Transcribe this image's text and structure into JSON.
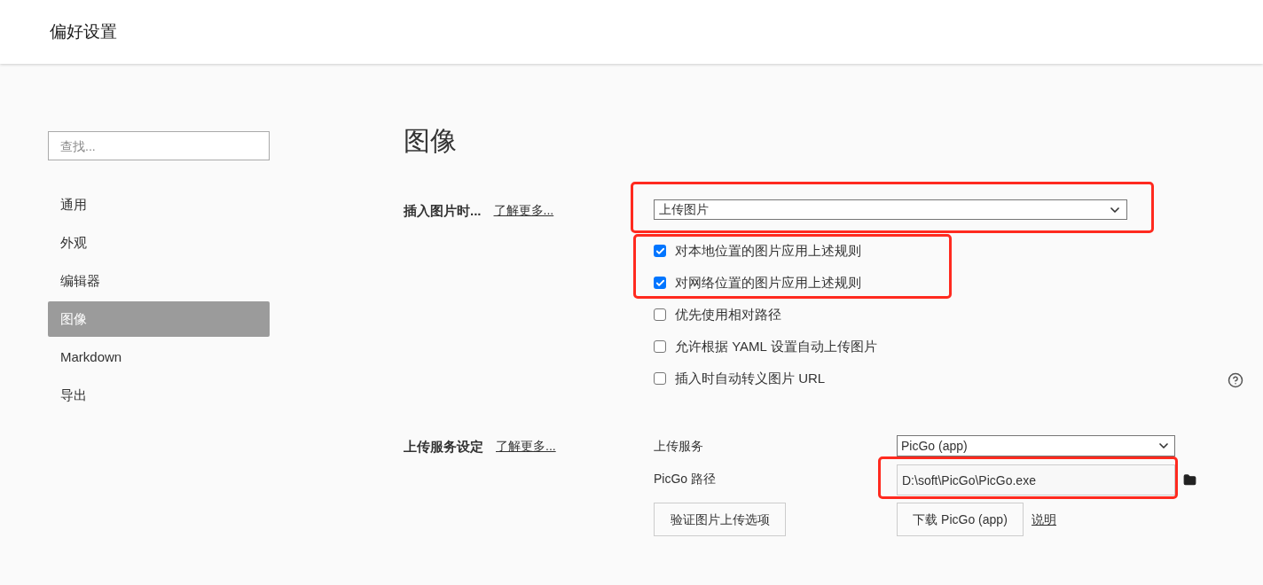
{
  "header": {
    "title": "偏好设置"
  },
  "sidebar": {
    "search": {
      "placeholder": "查找..."
    },
    "items": [
      {
        "label": "通用",
        "selected": false
      },
      {
        "label": "外观",
        "selected": false
      },
      {
        "label": "编辑器",
        "selected": false
      },
      {
        "label": "图像",
        "selected": true
      },
      {
        "label": "Markdown",
        "selected": false
      },
      {
        "label": "导出",
        "selected": false
      }
    ]
  },
  "page": {
    "title": "图像",
    "insert": {
      "label": "插入图片时...",
      "link": "了解更多...",
      "select": "上传图片",
      "options": [
        {
          "label": "对本地位置的图片应用上述规则",
          "checked": true
        },
        {
          "label": "对网络位置的图片应用上述规则",
          "checked": true
        },
        {
          "label": "优先使用相对路径",
          "checked": false
        },
        {
          "label": "允许根据 YAML 设置自动上传图片",
          "checked": false
        },
        {
          "label": "插入时自动转义图片 URL",
          "checked": false
        }
      ]
    },
    "upload": {
      "label": "上传服务设定",
      "link": "了解更多...",
      "service_label": "上传服务",
      "service": "PicGo (app)",
      "path_label": "PicGo 路径",
      "path": "D:\\soft\\PicGo\\PicGo.exe",
      "verify_button": "验证图片上传选项",
      "download_button": "下载 PicGo (app)",
      "help_link": "说明"
    }
  }
}
